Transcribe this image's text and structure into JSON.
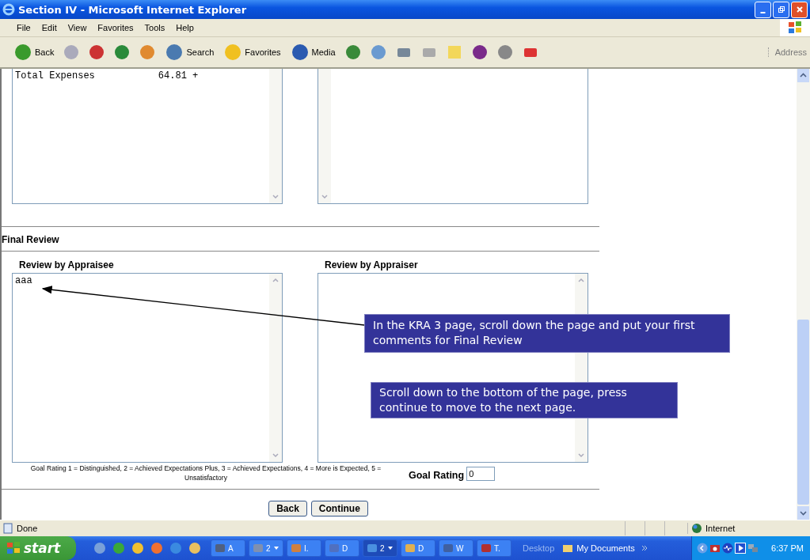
{
  "window": {
    "title": "Section IV - Microsoft Internet Explorer"
  },
  "menu": [
    "File",
    "Edit",
    "View",
    "Favorites",
    "Tools",
    "Help"
  ],
  "toolbar": [
    {
      "kind": "back",
      "label": "Back"
    },
    {
      "kind": "forward"
    },
    {
      "kind": "stop"
    },
    {
      "kind": "refresh"
    },
    {
      "kind": "home"
    },
    {
      "kind": "search",
      "label": "Search"
    },
    {
      "kind": "favorites",
      "label": "Favorites"
    },
    {
      "kind": "media",
      "label": "Media"
    },
    {
      "kind": "history"
    },
    {
      "kind": "mail"
    },
    {
      "kind": "print"
    },
    {
      "kind": "edit"
    },
    {
      "kind": "note"
    },
    {
      "kind": "messenger"
    },
    {
      "kind": "wand"
    },
    {
      "kind": "shop"
    }
  ],
  "address_label": "Address",
  "expenses": {
    "label": "Total Expenses",
    "amount": "64.81 +"
  },
  "section": "Final Review",
  "reviews": [
    {
      "label": "Review by Appraisee",
      "value": "aaa"
    },
    {
      "label": "Review by Appraiser"
    }
  ],
  "goal_legend": "Goal Rating 1 = Distinguished, 2 = Achieved Expectations Plus, 3 = Achieved Expectations,   4 = More is Expected, 5 = Unsatisfactory",
  "goal_rating": {
    "label": "Goal Rating",
    "value": "0"
  },
  "buttons": [
    "Back",
    "Continue"
  ],
  "callouts": [
    {
      "text": "In the KRA 3 page, scroll down the page and put your first comments for Final  Review",
      "arrow": true
    },
    {
      "text": "Scroll down to the bottom of the page, press continue to move to the next page.",
      "arrow": false
    }
  ],
  "status_bar": {
    "text": "Done",
    "zone": "Internet"
  },
  "taskbar": {
    "start": "start",
    "quick_launch": [
      {
        "kind": "doc"
      },
      {
        "kind": "green"
      },
      {
        "kind": "smiley"
      },
      {
        "kind": "player"
      },
      {
        "kind": "ie"
      },
      {
        "kind": "folder"
      }
    ],
    "tasks": [
      {
        "label": "A",
        "selected": false
      },
      {
        "label": "2",
        "dropdown": true,
        "selected": false
      },
      {
        "label": "I.",
        "selected": false
      },
      {
        "label": "D",
        "selected": false
      },
      {
        "label": "2",
        "dropdown": true,
        "selected": true
      },
      {
        "label": "D",
        "selected": false
      },
      {
        "label": "W",
        "selected": false
      },
      {
        "label": "T.",
        "selected": false
      }
    ],
    "toolbars": [
      "Desktop",
      "My Documents"
    ],
    "clock": "6:37 PM"
  }
}
